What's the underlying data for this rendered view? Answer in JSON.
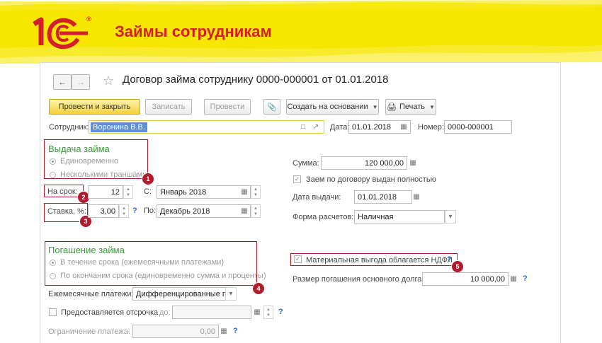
{
  "slide": {
    "title": "Займы сотрудникам",
    "logo_text": "1С",
    "logo_reg": "®"
  },
  "colors": {
    "brand_red": "#d41f2b",
    "highlight_yellow": "#f7e600",
    "section_green": "#3a9a3a",
    "annotation_red": "#b01c2b",
    "primary_button": "#f2d23f",
    "selection_blue": "#5b8fd6"
  },
  "window": {
    "title": "Договор займа сотруднику 0000-000001 от 01.01.2018",
    "nav": {
      "back_icon": "arrow-left-icon",
      "forward_icon": "arrow-right-icon",
      "favorite_icon": "star-icon"
    }
  },
  "toolbar": {
    "post_close": "Провести и закрыть",
    "save": "Записать",
    "post": "Провести",
    "create_based": "Создать на основании",
    "print": "Печать"
  },
  "header_fields": {
    "employee_label": "Сотрудник:",
    "employee_value": "Воронина В.В.",
    "date_label": "Дата:",
    "date_value": "01.01.2018",
    "number_label": "Номер:",
    "number_value": "0000-000001"
  },
  "issue": {
    "title": "Выдача займа",
    "option_once": "Единовременно",
    "option_tranches": "Несколькими траншами",
    "term_label": "На срок:",
    "term_value": "12",
    "from_label": "С:",
    "from_value": "Январь 2018",
    "rate_label": "Ставка, %:",
    "rate_value": "3,00",
    "to_label": "По:",
    "to_value": "Декабрь 2018",
    "sum_label": "Сумма:",
    "sum_value": "120 000,00",
    "issued_full_label": "Заем по договору выдан полностью",
    "issue_date_label": "Дата выдачи:",
    "issue_date_value": "01.01.2018",
    "payment_form_label": "Форма расчетов:",
    "payment_form_value": "Наличная"
  },
  "repayment": {
    "title": "Погашение займа",
    "option_monthly": "В течение срока (ежемесячными платежами)",
    "option_end": "По окончании срока (единовременно сумма и проценты)",
    "monthly_label": "Ежемесячные платежи:",
    "monthly_value": "Дифференцированные пла",
    "deferral_label": "Предоставляется отсрочка",
    "deferral_to_label": "до:",
    "limit_label": "Ограничение платежа:",
    "limit_value": "0,00",
    "ndfl_label": "Материальная выгода облагается НДФЛ",
    "principal_label": "Размер погашения основного долга:",
    "principal_value": "10 000,00"
  },
  "annotations": [
    "1",
    "2",
    "3",
    "4",
    "5"
  ],
  "help_mark": "?"
}
